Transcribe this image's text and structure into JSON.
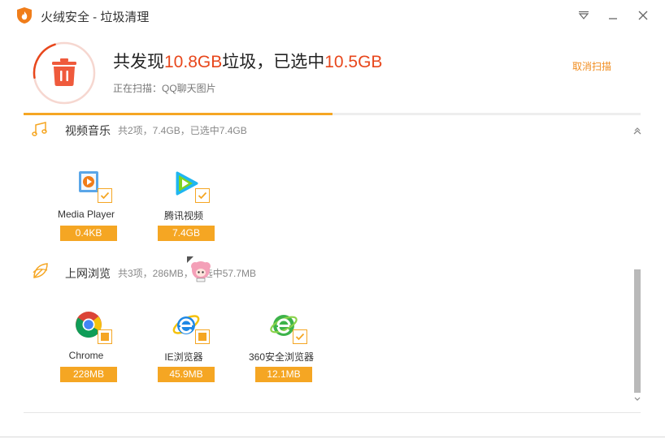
{
  "window": {
    "title": "火绒安全 - 垃圾清理"
  },
  "header": {
    "headline_prefix": "共发现",
    "found_size": "10.8GB",
    "headline_middle": "垃圾，已选中",
    "selected_size": "10.5GB",
    "scan_status": "正在扫描：QQ聊天图片",
    "cancel_label": "取消扫描",
    "scan_progress": 0.5
  },
  "categories": [
    {
      "name": "视频音乐",
      "summary": "共2项，7.4GB，已选中7.4GB",
      "icon": "music-note-icon",
      "items": [
        {
          "name": "Media Player",
          "size": "0.4KB",
          "icon": "media-player-icon",
          "checked": "checked"
        },
        {
          "name": "腾讯视频",
          "size": "7.4GB",
          "icon": "tencent-video-icon",
          "checked": "checked"
        }
      ]
    },
    {
      "name": "上网浏览",
      "summary": "共3项，286MB，已选中57.7MB",
      "icon": "browser-leaf-icon",
      "items": [
        {
          "name": "Chrome",
          "size": "228MB",
          "icon": "chrome-icon",
          "checked": "partial"
        },
        {
          "name": "IE浏览器",
          "size": "45.9MB",
          "icon": "ie-icon",
          "checked": "partial"
        },
        {
          "name": "360安全浏览器",
          "size": "12.1MB",
          "icon": "360-browser-icon",
          "checked": "checked"
        }
      ]
    }
  ],
  "colors": {
    "accent_orange": "#f5a623",
    "highlight_red": "#e8471c",
    "link_orange": "#f08c1e"
  }
}
